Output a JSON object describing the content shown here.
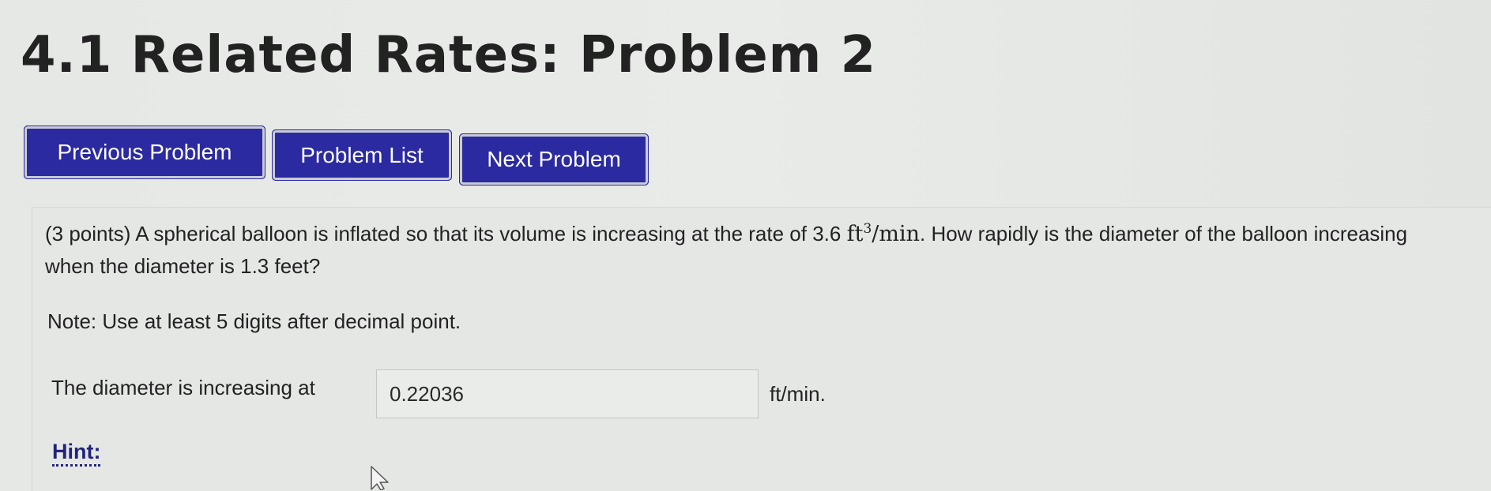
{
  "page": {
    "title": "4.1 Related Rates: Problem 2"
  },
  "nav": {
    "previous": "Previous Problem",
    "list": "Problem List",
    "next": "Next Problem"
  },
  "problem": {
    "points": "(3 points)",
    "text_before_rate": "A spherical balloon is inflated so that its volume is increasing at the rate of 3.6",
    "rate_unit_base": "ft",
    "rate_unit_exp": "3",
    "rate_unit_per": "/min",
    "text_after_rate": ". How rapidly is the diameter of the balloon increasing when the diameter is 1.3 feet?",
    "note": "Note: Use at least 5 digits after decimal point."
  },
  "answer": {
    "label": "The diameter is increasing at",
    "value": "0.22036",
    "unit": "ft/min."
  },
  "hint": {
    "label": "Hint:"
  },
  "icons": {
    "cursor": "mouse-pointer-icon"
  },
  "colors": {
    "button_bg": "#2b2aa0",
    "button_text": "#ffffff",
    "hint_link": "#23237a"
  }
}
